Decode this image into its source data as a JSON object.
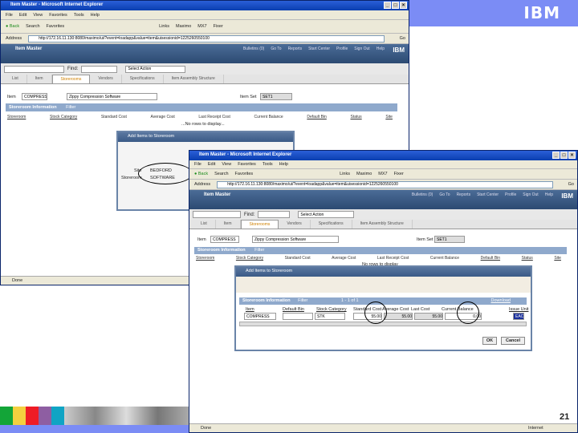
{
  "slide": {
    "logo": "IBM",
    "page_number": "21",
    "colors": {
      "banner": "#7b8cf5",
      "stripes": [
        "#13a538",
        "#f4d03f",
        "#ee1c25",
        "#8e5ea2",
        "#10a4c4"
      ]
    }
  },
  "window1": {
    "title": "Item Master - Microsoft Internet Explorer",
    "menu": [
      "File",
      "Edit",
      "View",
      "Favorites",
      "Tools",
      "Help"
    ],
    "toolbar": [
      "Back",
      "Search",
      "Favorites",
      "Links",
      "Maximo",
      "MX7",
      "Fixer"
    ],
    "address_label": "Address",
    "address": "http://172.16.11.130:8080/maximo/ui/?event=loadapp&value=item&uisessionid=1225260550100",
    "go": "Go",
    "app_title": "Item Master",
    "header_links": [
      "Bulletins (0)",
      "Go To",
      "Reports",
      "Start Center",
      "Profile",
      "Sign Out",
      "Help"
    ],
    "find_label": "Find:",
    "select_action": "Select Action",
    "tabs": [
      "List",
      "Item",
      "Storerooms",
      "Vendors",
      "Specifications",
      "Item Assembly Structure"
    ],
    "active_tab": "Storerooms",
    "item_label": "Item",
    "item_value": "COMPRESS",
    "item_desc": "Zippy Compression Software",
    "itemset_label": "Item Set",
    "itemset_value": "SET1",
    "section": "Storeroom Information",
    "filter": "Filter",
    "columns": [
      "Storeroom",
      "Stock Category",
      "Standard Cost",
      "Average Cost",
      "Last Receipt Cost",
      "Current Balance",
      "Default Bin",
      "Status",
      "Site"
    ],
    "empty": "...No rows to display...",
    "status": "Done"
  },
  "dialog1": {
    "title": "Add Items to Storeroom",
    "site_label": "Site",
    "site_value": "BEDFORD",
    "storeroom_label": "Storeroom",
    "storeroom_value": "SOFTWARE"
  },
  "window2": {
    "title": "Item Master - Microsoft Internet Explorer",
    "menu": [
      "File",
      "Edit",
      "View",
      "Favorites",
      "Tools",
      "Help"
    ],
    "toolbar": [
      "Back",
      "Search",
      "Favorites",
      "Links",
      "Maximo",
      "MX7",
      "Fixer"
    ],
    "address_label": "Address",
    "address": "http://172.16.11.130:8080/maximo/ui/?event=loadapp&value=item&uisessionid=1225260550100",
    "go": "Go",
    "app_title": "Item Master",
    "header_links": [
      "Bulletins (0)",
      "Go To",
      "Reports",
      "Start Center",
      "Profile",
      "Sign Out",
      "Help"
    ],
    "find_label": "Find:",
    "select_action": "Select Action",
    "tabs": [
      "List",
      "Item",
      "Storerooms",
      "Vendors",
      "Specifications",
      "Item Assembly Structure"
    ],
    "item_label": "Item",
    "item_value": "COMPRESS",
    "item_desc": "Zippy Compression Software",
    "itemset_label": "Item Set",
    "itemset_value": "SET1",
    "section": "Storeroom Information",
    "filter": "Filter",
    "columns": [
      "Storeroom",
      "Stock Category",
      "Standard Cost",
      "Average Cost",
      "Last Receipt Cost",
      "Current Balance",
      "Default Bin",
      "Status",
      "Site"
    ],
    "empty": "No rows to display",
    "status": "Done",
    "zone": "Internet"
  },
  "dialog2": {
    "title": "Add Items to Storeroom",
    "section": "Storeroom Information",
    "filter": "Filter",
    "pager": "1 - 1 of 1",
    "download": "Download",
    "columns": [
      "Item",
      "Default Bin",
      "Stock Category",
      "Standard Cost",
      "Average Cost",
      "Last Cost",
      "Current Balance",
      "Issue Unit"
    ],
    "row": {
      "item": "COMPRESS",
      "bin": "",
      "category": "STK",
      "standard": "55.00",
      "average": "55.00",
      "last": "55.00",
      "balance": "0.00",
      "unit": "EACH"
    },
    "ok": "OK",
    "cancel": "Cancel"
  }
}
